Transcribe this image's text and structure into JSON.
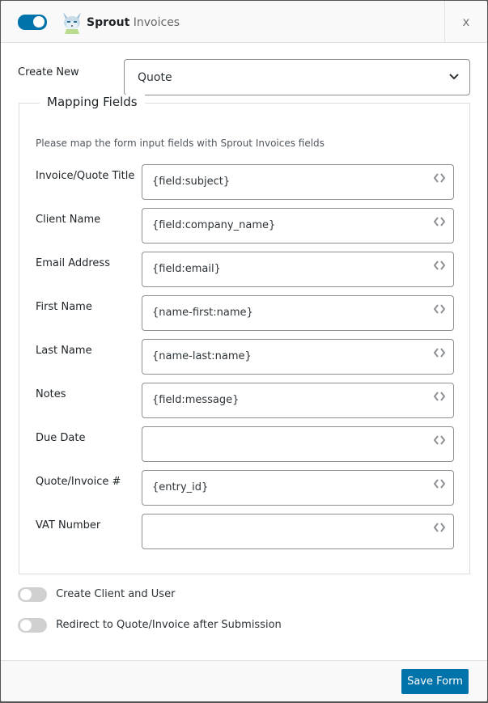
{
  "header": {
    "enabled": true,
    "brand_bold": "Sprout",
    "brand_light": "Invoices",
    "close_label": "x"
  },
  "create_new": {
    "label": "Create New",
    "selected": "Quote"
  },
  "mapping": {
    "legend": "Mapping Fields",
    "description": "Please map the form input fields with Sprout Invoices fields",
    "fields": [
      {
        "label": "Invoice/Quote Title",
        "value": "{field:subject}"
      },
      {
        "label": "Client Name",
        "value": "{field:company_name}"
      },
      {
        "label": "Email Address",
        "value": "{field:email}"
      },
      {
        "label": "First Name",
        "value": "{name-first:name}"
      },
      {
        "label": "Last Name",
        "value": "{name-last:name}"
      },
      {
        "label": "Notes",
        "value": "{field:message}"
      },
      {
        "label": "Due Date",
        "value": ""
      },
      {
        "label": "Quote/Invoice #",
        "value": "{entry_id}"
      },
      {
        "label": "VAT Number",
        "value": ""
      }
    ]
  },
  "options": [
    {
      "label": "Create Client and User",
      "enabled": false
    },
    {
      "label": "Redirect to Quote/Invoice after Submission",
      "enabled": false
    }
  ],
  "footer": {
    "save_label": "Save Form"
  },
  "colors": {
    "accent": "#0073aa",
    "toggle_off": "#d0d0d0"
  }
}
